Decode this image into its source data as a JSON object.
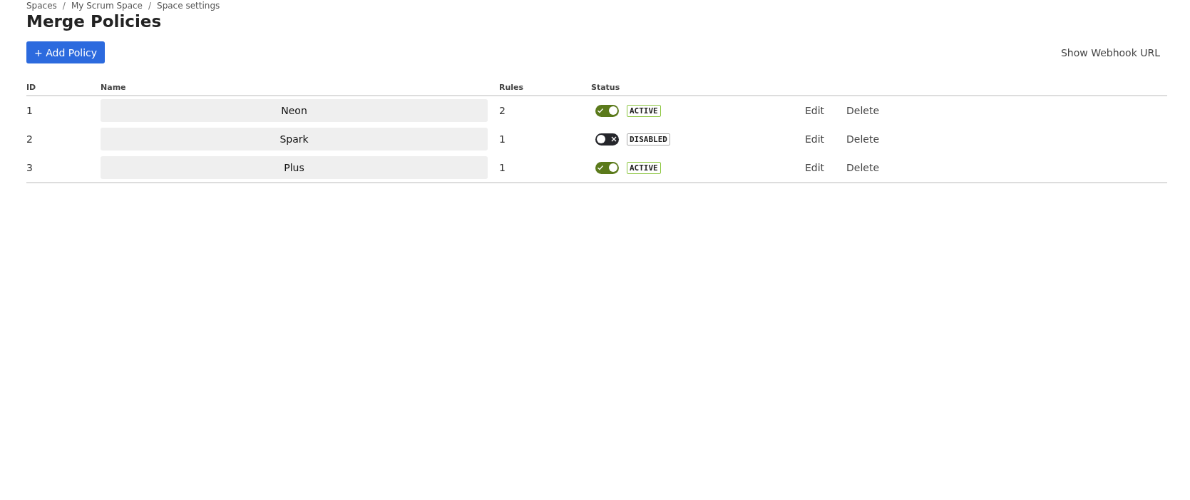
{
  "breadcrumb": {
    "items": [
      "Spaces",
      "My Scrum Space",
      "Space settings"
    ],
    "separator": "/"
  },
  "title": "Merge Policies",
  "add_button": "+ Add Policy",
  "webhook_link": "Show Webhook URL",
  "table": {
    "columns": [
      "ID",
      "Name",
      "Rules",
      "Status"
    ],
    "rows": [
      {
        "id": "1",
        "name": "Neon",
        "rules": "2",
        "active": true,
        "status": "ACTIVE",
        "actions": [
          "Edit",
          "Delete"
        ]
      },
      {
        "id": "2",
        "name": "Spark",
        "rules": "1",
        "active": false,
        "status": "DISABLED",
        "actions": [
          "Edit",
          "Delete"
        ]
      },
      {
        "id": "3",
        "name": "Plus",
        "rules": "1",
        "active": true,
        "status": "ACTIVE",
        "actions": [
          "Edit",
          "Delete"
        ]
      }
    ]
  }
}
